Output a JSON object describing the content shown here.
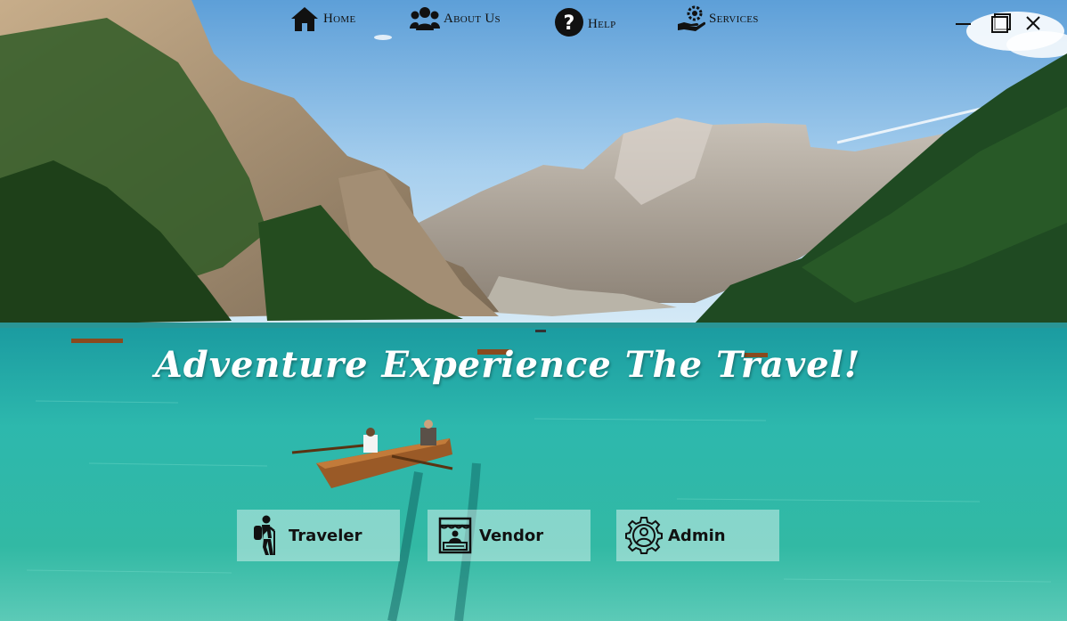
{
  "nav": {
    "items": [
      {
        "label": "Home",
        "icon": "home-icon"
      },
      {
        "label": "About Us",
        "icon": "users-icon"
      },
      {
        "label": "Help",
        "icon": "question-icon"
      },
      {
        "label": "Services",
        "icon": "services-icon"
      }
    ]
  },
  "window_controls": [
    "minimize",
    "maximize",
    "close"
  ],
  "hero": {
    "headline": "Adventure Experience The Travel!"
  },
  "roles": [
    {
      "label": "Traveler",
      "icon": "hiker-icon"
    },
    {
      "label": "Vendor",
      "icon": "vendor-stall-icon"
    },
    {
      "label": "Admin",
      "icon": "admin-gear-icon"
    }
  ],
  "colors": {
    "sky": "#8fc3ea",
    "lake": "#2fb3a8",
    "forest": "#1f4a22",
    "headline": "#ffffff",
    "button_bg": "rgba(255,255,255,0.42)"
  }
}
